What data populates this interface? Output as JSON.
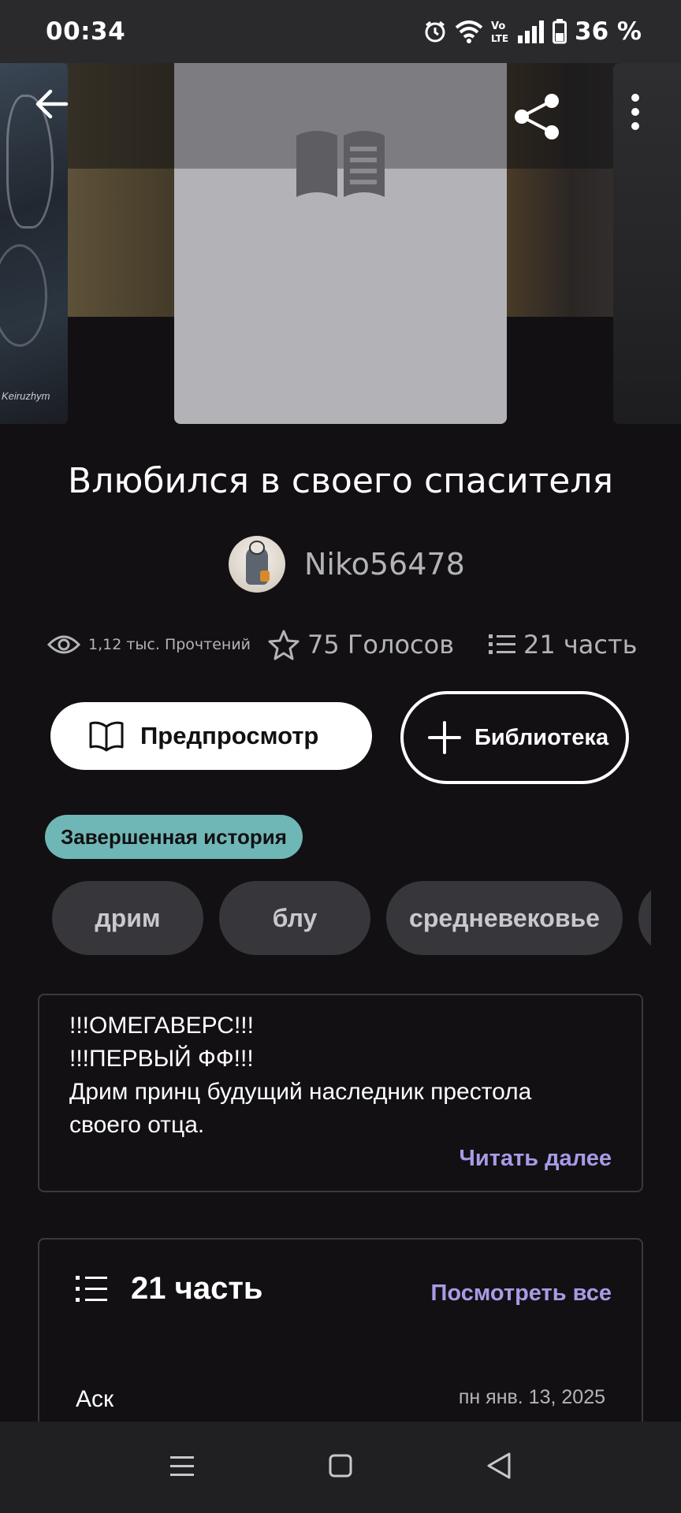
{
  "status_bar": {
    "time": "00:34",
    "battery": "36 %",
    "icons": [
      "alarm-icon",
      "wifi-icon",
      "volte-icon",
      "signal-icon",
      "battery-icon"
    ]
  },
  "top_bar": {
    "back_icon": "arrow-left-icon",
    "share_icon": "share-icon",
    "more_icon": "more-vertical-icon"
  },
  "story": {
    "title": "Влюбился в своего спасителя",
    "author": "Niko56478"
  },
  "stats": {
    "reads": "1,12 тыс. Прочтений",
    "votes": "75 Голосов",
    "parts": "21 часть"
  },
  "actions": {
    "preview_label": "Предпросмотр",
    "library_label": "Библиотека"
  },
  "badge": {
    "label": "Завершенная история"
  },
  "tags": [
    "дрим",
    "блу",
    "средневековье",
    ""
  ],
  "description": {
    "lines": [
      "!!!ОМЕГАВЕРС!!!",
      "!!!ПЕРВЫЙ ФФ!!!",
      "Дрим принц будущий наследник престола",
      "своего отца."
    ],
    "read_more": "Читать далее"
  },
  "parts_section": {
    "title": "21 часть",
    "see_all": "Посмотреть все",
    "first_part": {
      "name": "Аск",
      "date": "пн янв. 13, 2025"
    }
  },
  "colors": {
    "background": "#121013",
    "accent": "#a89be6",
    "badge": "#6fb7b6",
    "tag_bg": "#37363a"
  }
}
